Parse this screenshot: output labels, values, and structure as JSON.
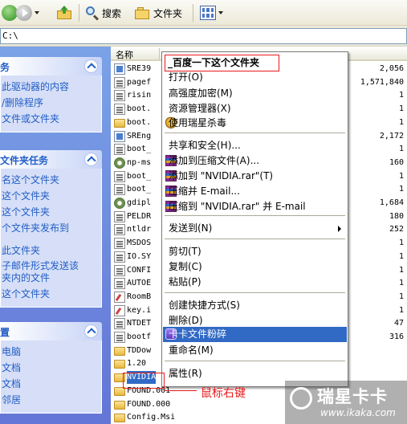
{
  "toolbar": {
    "search_label": "搜索",
    "folders_label": "文件夹"
  },
  "address": {
    "value": "C:\\"
  },
  "left_pane": {
    "system_tasks": {
      "title": "务",
      "links": [
        "此驱动器的内容",
        "/删除程序",
        "文件或文件夹"
      ]
    },
    "file_tasks": {
      "title": "文件夹任务",
      "links": [
        "名这个文件夹",
        "这个文件夹",
        "这个文件夹",
        "个文件夹发布到",
        "此文件夹",
        "子邮件形式发送该\n夹内的文件",
        "这个文件夹"
      ]
    },
    "other_places": {
      "title": "置",
      "links": [
        "电脑",
        "文档",
        "文档",
        "邻居"
      ]
    }
  },
  "file_list": {
    "name_header": "名称",
    "files": [
      {
        "name": "SRE39",
        "size": "2,056",
        "icon": "exe"
      },
      {
        "name": "pagef",
        "size": "1,571,840",
        "icon": "sys"
      },
      {
        "name": "risin",
        "size": "1",
        "icon": "sys"
      },
      {
        "name": "boot.",
        "size": "1",
        "icon": "sys"
      },
      {
        "name": "boot.",
        "size": "1",
        "icon": "folder"
      },
      {
        "name": "SREng",
        "size": "2,172",
        "icon": "exe"
      },
      {
        "name": "boot_",
        "size": "1",
        "icon": "sys"
      },
      {
        "name": "np-ms",
        "size": "160",
        "icon": "gear"
      },
      {
        "name": "boot_",
        "size": "1",
        "icon": "sys"
      },
      {
        "name": "boot_",
        "size": "1",
        "icon": "sys"
      },
      {
        "name": "gdipl",
        "size": "1,684",
        "icon": "gear"
      },
      {
        "name": "PELDR",
        "size": "180",
        "icon": "sys"
      },
      {
        "name": "ntldr",
        "size": "252",
        "icon": "sys"
      },
      {
        "name": "MSDOS",
        "size": "1",
        "icon": "sys"
      },
      {
        "name": "IO.SY",
        "size": "1",
        "icon": "sys"
      },
      {
        "name": "CONFI",
        "size": "1",
        "icon": "sys"
      },
      {
        "name": "AUTOE",
        "size": "1",
        "icon": "sys"
      },
      {
        "name": "RoomB",
        "size": "1",
        "icon": "wrench"
      },
      {
        "name": "key.i",
        "size": "1",
        "icon": "wrench"
      },
      {
        "name": "NTDET",
        "size": "47",
        "icon": "sys"
      },
      {
        "name": "bootf",
        "size": "316",
        "icon": "sys"
      },
      {
        "name": "TDDow",
        "size": "",
        "icon": "folder"
      },
      {
        "name": "1.20",
        "size": "",
        "icon": "folder"
      },
      {
        "name": "NVIDIA",
        "size": "",
        "icon": "folder",
        "selected": true
      },
      {
        "name": "FOUND.001",
        "size": "",
        "icon": "folder"
      },
      {
        "name": "FOUND.000",
        "size": "",
        "icon": "folder"
      },
      {
        "name": "Config.Msi",
        "size": "",
        "icon": "folder"
      }
    ]
  },
  "context_menu": {
    "title": "_百度一下这个文件夹",
    "items": [
      {
        "label": "打开(O)",
        "icon": ""
      },
      {
        "label": "高强度加密(M)",
        "icon": ""
      },
      {
        "label": "资源管理器(X)",
        "icon": ""
      },
      {
        "label": "使用瑞星杀毒",
        "icon": "shield"
      },
      {
        "label": "共享和安全(H)...",
        "icon": ""
      },
      {
        "label": "添加到压缩文件(A)...",
        "icon": "rar"
      },
      {
        "label": "添加到 \"NVIDIA.rar\"(T)",
        "icon": "rar"
      },
      {
        "label": "压缩并 E-mail...",
        "icon": "rar"
      },
      {
        "label": "压缩到 \"NVIDIA.rar\" 并 E-mail",
        "icon": "rar"
      },
      {
        "label": "发送到(N)",
        "icon": ""
      },
      {
        "label": "剪切(T)",
        "icon": ""
      },
      {
        "label": "复制(C)",
        "icon": ""
      },
      {
        "label": "粘贴(P)",
        "icon": ""
      },
      {
        "label": "创建快捷方式(S)",
        "icon": ""
      },
      {
        "label": "删除(D)",
        "icon": ""
      },
      {
        "label": "卡卡文件粉碎",
        "icon": "kaka",
        "highlighted": true
      },
      {
        "label": "重命名(M)",
        "icon": ""
      },
      {
        "label": "属性(R)",
        "icon": ""
      }
    ]
  },
  "annotation": {
    "label": "鼠标右键",
    "color": "#e81a1a"
  },
  "watermark": {
    "logo": "瑞星卡卡",
    "url": "www.ikaka.com"
  },
  "colors": {
    "selection": "#316ac5",
    "task_pane": "#6375d6",
    "link": "#215dc6"
  }
}
